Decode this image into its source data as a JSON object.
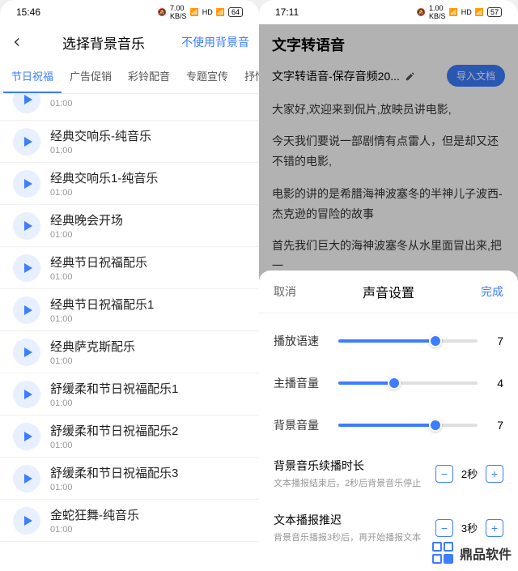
{
  "left": {
    "status": {
      "time": "15:46",
      "net_speed": "7.00",
      "net_unit": "KB/S",
      "battery": "64"
    },
    "header": {
      "title": "选择背景音乐",
      "action": "不使用背景音"
    },
    "tabs": [
      "节日祝福",
      "广告促销",
      "彩铃配音",
      "专题宣传",
      "抒情"
    ],
    "active_tab_index": 0,
    "tracks": [
      {
        "title": "",
        "time": "01:00"
      },
      {
        "title": "经典交响乐-纯音乐",
        "time": "01:00"
      },
      {
        "title": "经典交响乐1-纯音乐",
        "time": "01:00"
      },
      {
        "title": "经典晚会开场",
        "time": "01:00"
      },
      {
        "title": "经典节日祝福配乐",
        "time": "01:00"
      },
      {
        "title": "经典节日祝福配乐1",
        "time": "01:00"
      },
      {
        "title": "经典萨克斯配乐",
        "time": "01:00"
      },
      {
        "title": "舒缓柔和节日祝福配乐1",
        "time": "01:00"
      },
      {
        "title": "舒缓柔和节日祝福配乐2",
        "time": "01:00"
      },
      {
        "title": "舒缓柔和节日祝福配乐3",
        "time": "01:00"
      },
      {
        "title": "金蛇狂舞-纯音乐",
        "time": "01:00"
      }
    ]
  },
  "right": {
    "status": {
      "time": "17:11",
      "net_speed": "1.00",
      "net_unit": "KB/S",
      "battery": "57"
    },
    "page_title": "文字转语音",
    "file_name": "文字转语音-保存音频20...",
    "import_label": "导入文档",
    "body_paragraphs": [
      "大家好,欢迎来到侃片,放映员讲电影,",
      "今天我们要说一部剧情有点雷人，但是却又还不错的电影,",
      "电影的讲的是希腊海神波塞冬的半神儿子波西-杰克逊的冒险的故事",
      "首先我们巨大的海神波塞冬从水里面冒出来,把一"
    ],
    "sheet": {
      "cancel": "取消",
      "title": "声音设置",
      "done": "完成",
      "sliders": [
        {
          "label": "播放语速",
          "value": 7,
          "max": 10
        },
        {
          "label": "主播音量",
          "value": 4,
          "max": 10
        },
        {
          "label": "背景音量",
          "value": 7,
          "max": 10
        }
      ],
      "settings": [
        {
          "label": "背景音乐续播时长",
          "desc": "文本播报结束后，2秒后背景音乐停止",
          "value": "2秒"
        },
        {
          "label": "文本播报推迟",
          "desc": "背景音乐播报3秒后，再开始播报文本",
          "value": "3秒"
        }
      ]
    }
  },
  "watermark": "鼎品软件"
}
